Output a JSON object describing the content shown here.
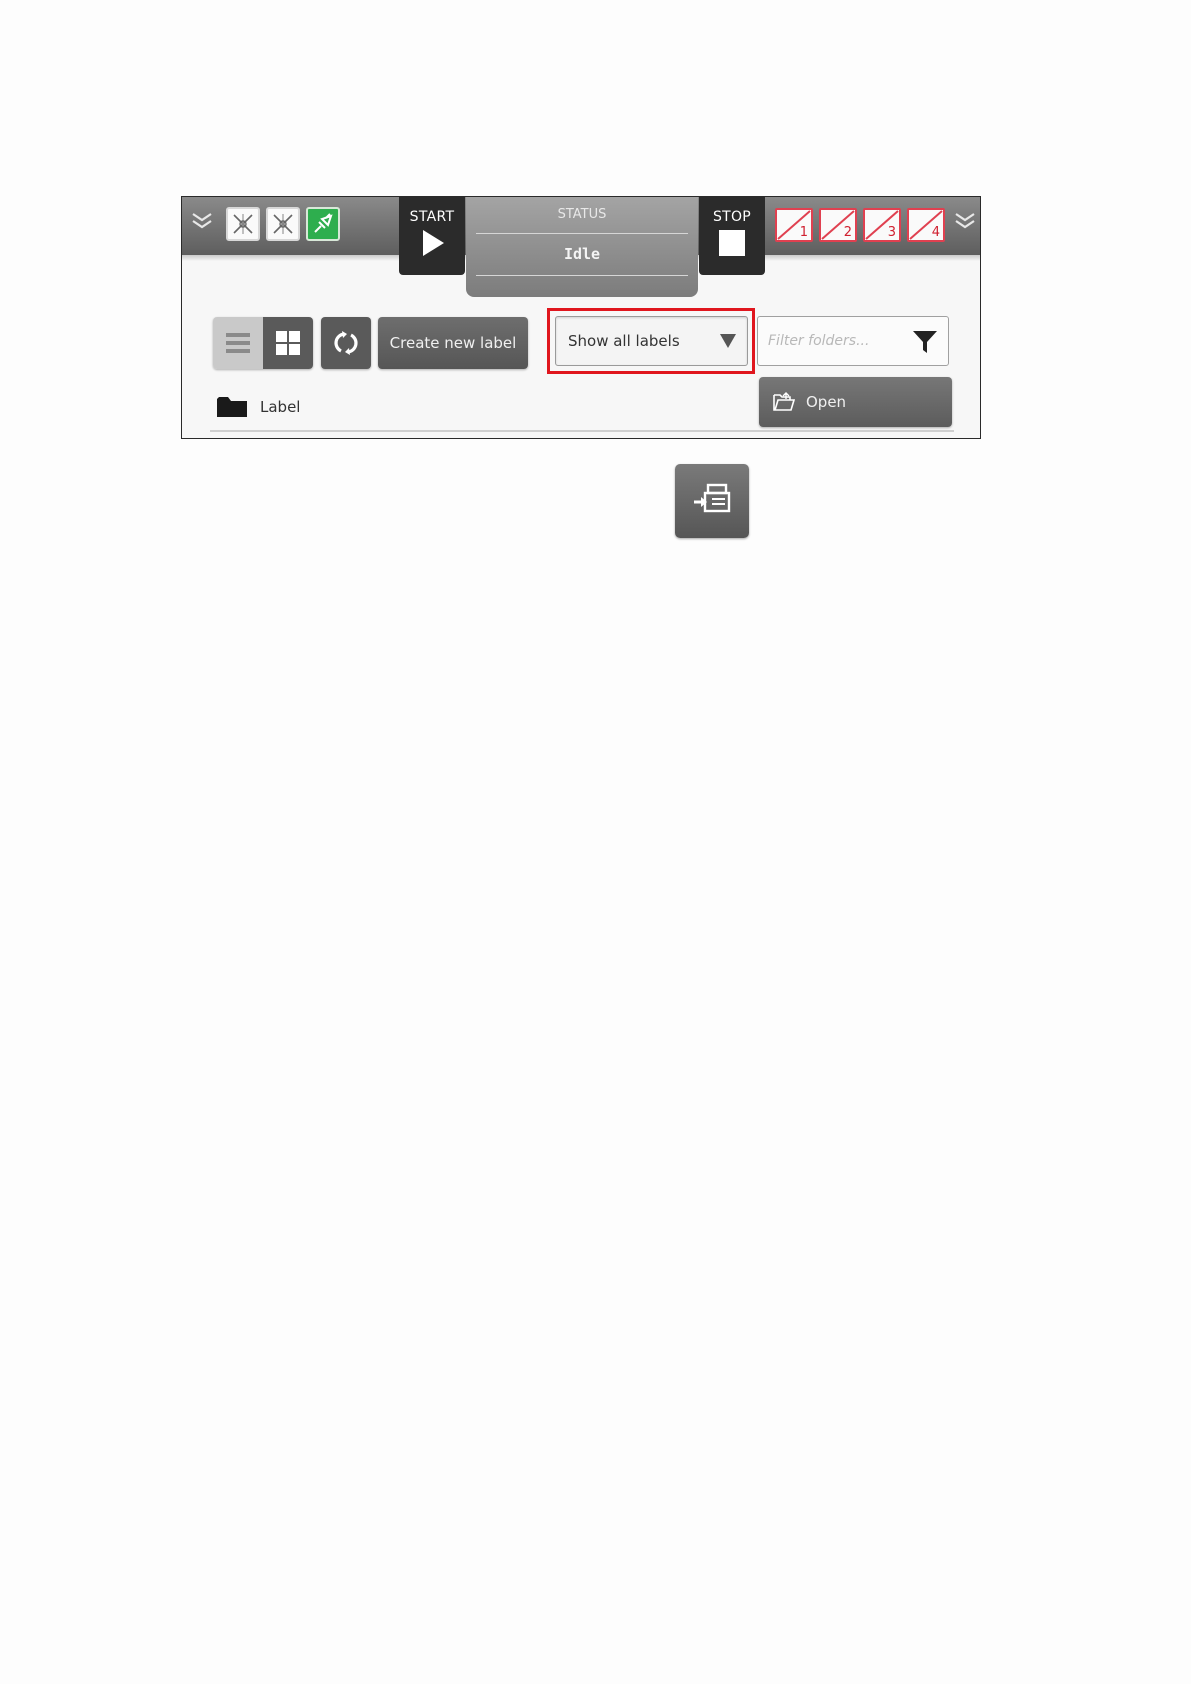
{
  "topbar": {
    "left_expand_icon": "double-chevron-down-icon",
    "right_expand_icon": "double-chevron-down-icon",
    "devices": [
      {
        "icon": "device-disconnected-icon",
        "state": "inactive"
      },
      {
        "icon": "device-disconnected-icon",
        "state": "inactive"
      },
      {
        "icon": "device-connected-icon",
        "state": "active",
        "color": "#2eae4e"
      }
    ],
    "start_label": "START",
    "stop_label": "STOP",
    "status": {
      "title": "STATUS",
      "value": "Idle"
    },
    "slots": [
      {
        "number": "1",
        "state": "empty"
      },
      {
        "number": "2",
        "state": "empty"
      },
      {
        "number": "3",
        "state": "empty"
      },
      {
        "number": "4",
        "state": "empty"
      }
    ]
  },
  "toolbar": {
    "create_label": "Create new label",
    "filter_dropdown": {
      "selected": "Show all labels"
    },
    "filter_folders": {
      "placeholder": "Filter folders...",
      "value": ""
    }
  },
  "folders": {
    "items": [
      {
        "label": "Label",
        "icon": "folder-icon"
      }
    ],
    "open_label": "Open"
  },
  "accent_colors": {
    "highlight": "#e0161e",
    "active_device": "#2eae4e",
    "slot_error": "#e04050"
  }
}
